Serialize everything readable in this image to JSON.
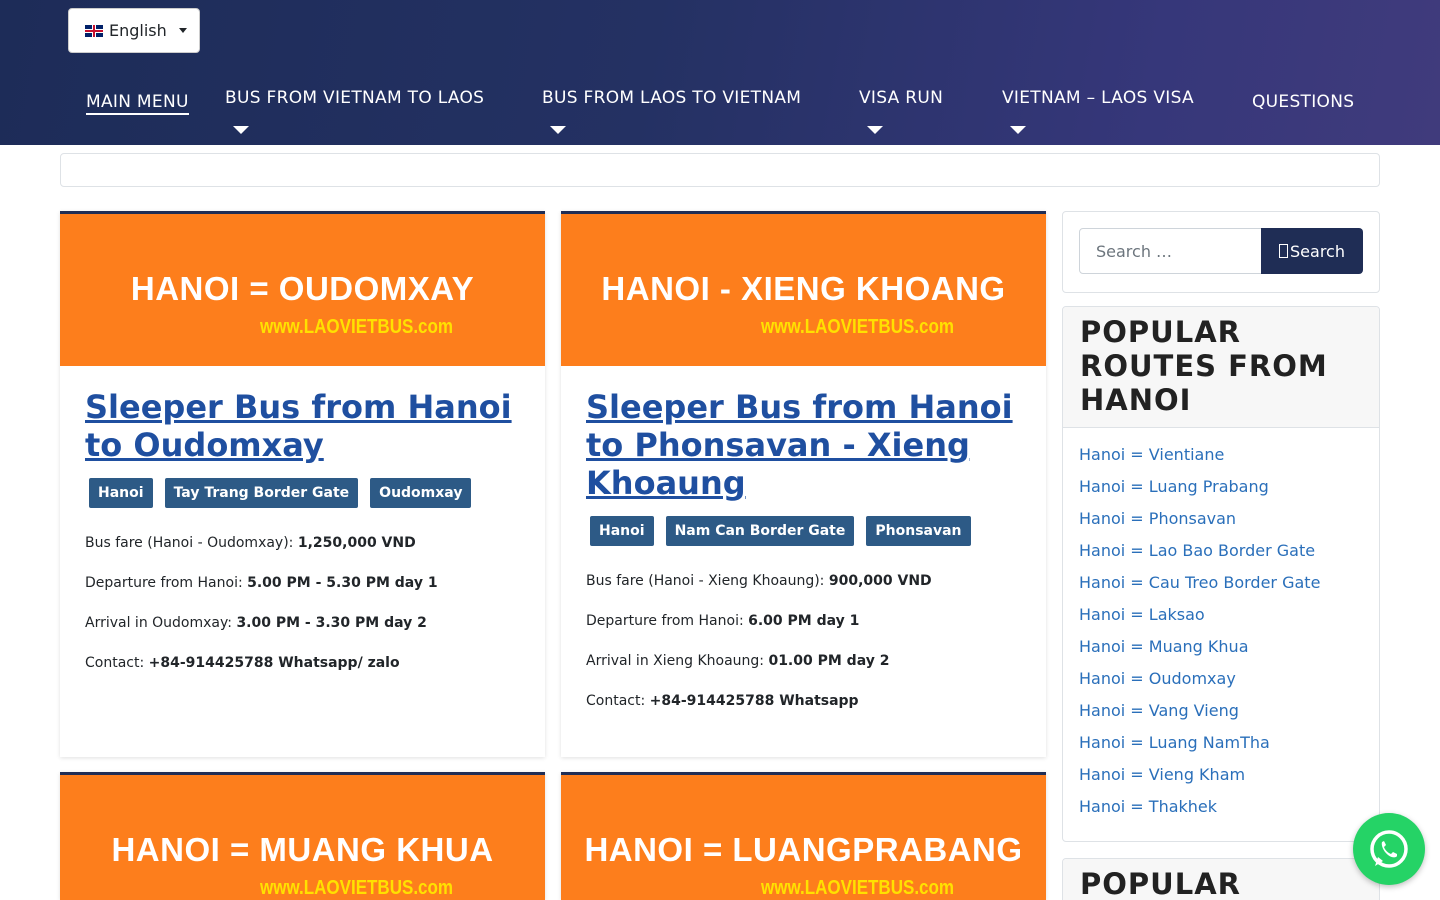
{
  "header": {
    "language": "English",
    "nav": [
      {
        "label": "MAIN MENU"
      },
      {
        "label": "BUS FROM VIETNAM TO LAOS"
      },
      {
        "label": "BUS FROM LAOS TO VIETNAM"
      },
      {
        "label": "VISA RUN"
      },
      {
        "label": "VIETNAM – LAOS VISA"
      },
      {
        "label": "QUESTIONS"
      }
    ]
  },
  "cards": [
    {
      "image_title": "HANOI = OUDOMXAY",
      "image_site": "www.LAOVIETBUS.com",
      "title": "Sleeper Bus from Hanoi to Oudomxay",
      "tags": [
        "Hanoi",
        "Tay Trang Border Gate",
        "Oudomxay"
      ],
      "info": [
        {
          "label": "Bus fare (Hanoi - Oudomxay): ",
          "value": "1,250,000 VND"
        },
        {
          "label": "Departure from Hanoi: ",
          "value": "5.00 PM - 5.30 PM day 1"
        },
        {
          "label": "Arrival in Oudomxay: ",
          "value": "3.00 PM - 3.30 PM day 2"
        },
        {
          "label": "Contact: ",
          "value": "+84-914425788 Whatsapp/ zalo"
        }
      ]
    },
    {
      "image_title": "HANOI - XIENG KHOANG",
      "image_site": "www.LAOVIETBUS.com",
      "title": "Sleeper Bus from Hanoi to Phonsavan - Xieng Khoaung",
      "tags": [
        "Hanoi",
        "Nam Can Border Gate",
        "Phonsavan"
      ],
      "info": [
        {
          "label": "Bus fare (Hanoi - Xieng Khoaung): ",
          "value": "900,000 VND"
        },
        {
          "label": "Departure from Hanoi: ",
          "value": "6.00 PM day 1"
        },
        {
          "label": "Arrival in Xieng Khoaung: ",
          "value": "01.00 PM day 2"
        },
        {
          "label": "Contact: ",
          "value": "+84-914425788 Whatsapp"
        }
      ]
    },
    {
      "image_title": "HANOI = MUANG KHUA",
      "image_site": "www.LAOVIETBUS.com"
    },
    {
      "image_title": "HANOI = LUANGPRABANG",
      "image_site": "www.LAOVIETBUS.com"
    }
  ],
  "sidebar": {
    "search_placeholder": "Search …",
    "search_button": "Search",
    "popular_title": "POPULAR ROUTES FROM HANOI",
    "routes": [
      "Hanoi = Vientiane",
      "Hanoi = Luang Prabang",
      "Hanoi = Phonsavan",
      "Hanoi = Lao Bao Border Gate",
      "Hanoi = Cau Treo Border Gate",
      "Hanoi = Laksao",
      "Hanoi = Muang Khua",
      "Hanoi = Oudomxay",
      "Hanoi = Vang Vieng",
      "Hanoi = Luang NamTha",
      "Hanoi = Vieng Kham",
      "Hanoi = Thakhek"
    ],
    "second_widget_title": "POPULAR"
  },
  "icons": {
    "flag": "uk-flag-icon",
    "whatsapp": "whatsapp-icon"
  },
  "colors": {
    "header_bg": "#243163",
    "card_orange": "#fd7e1c",
    "tag_bg": "#2d5a86",
    "link": "#1f4fa0",
    "whatsapp": "#25d366"
  }
}
